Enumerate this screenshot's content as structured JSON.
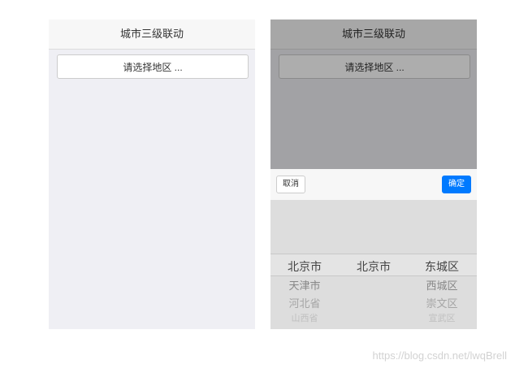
{
  "left_screen": {
    "title": "城市三级联动",
    "select_button": "请选择地区 ..."
  },
  "right_screen": {
    "title": "城市三级联动",
    "select_button": "请选择地区 ...",
    "picker": {
      "cancel_label": "取消",
      "confirm_label": "确定",
      "provinces": [
        "北京市",
        "天津市",
        "河北省",
        "山西省"
      ],
      "cities": [
        "北京市"
      ],
      "districts": [
        "东城区",
        "西城区",
        "崇文区",
        "宣武区"
      ]
    }
  },
  "watermark": "https://blog.csdn.net/lwqBrell",
  "colors": {
    "confirm": "#007aff",
    "background": "#efeff4"
  }
}
